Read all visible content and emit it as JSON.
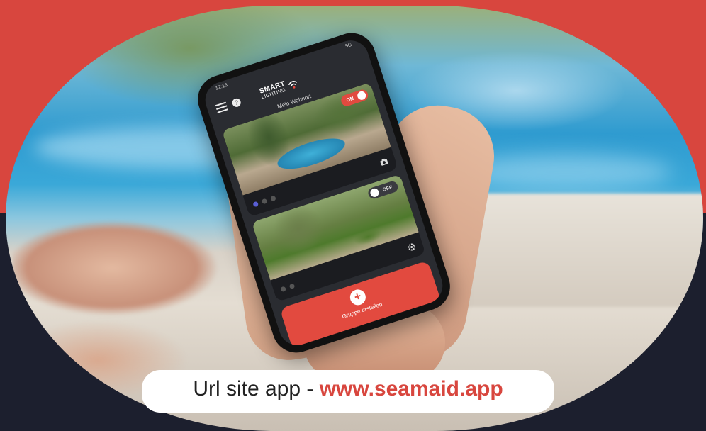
{
  "app": {
    "logo_line1": "SMART",
    "logo_line2": "LIGHTING",
    "location": "Mein Wohnort"
  },
  "statusbar": {
    "time": "12:13",
    "icons": "5G"
  },
  "cards": [
    {
      "toggle_label": "ON",
      "state": "on"
    },
    {
      "toggle_label": "OFF",
      "state": "off"
    }
  ],
  "group": {
    "label": "Gruppe erstellen",
    "plus": "+"
  },
  "banner": {
    "prefix": "Url site app - ",
    "url": "www.seamaid.app"
  },
  "colors": {
    "brand_red": "#d8463e",
    "navy": "#1c1f2e",
    "indigo_dot": "#5a5fd6"
  },
  "icons": [
    "menu-icon",
    "help-icon",
    "wifi-icon",
    "camera-icon",
    "gear-icon",
    "plus-icon"
  ]
}
